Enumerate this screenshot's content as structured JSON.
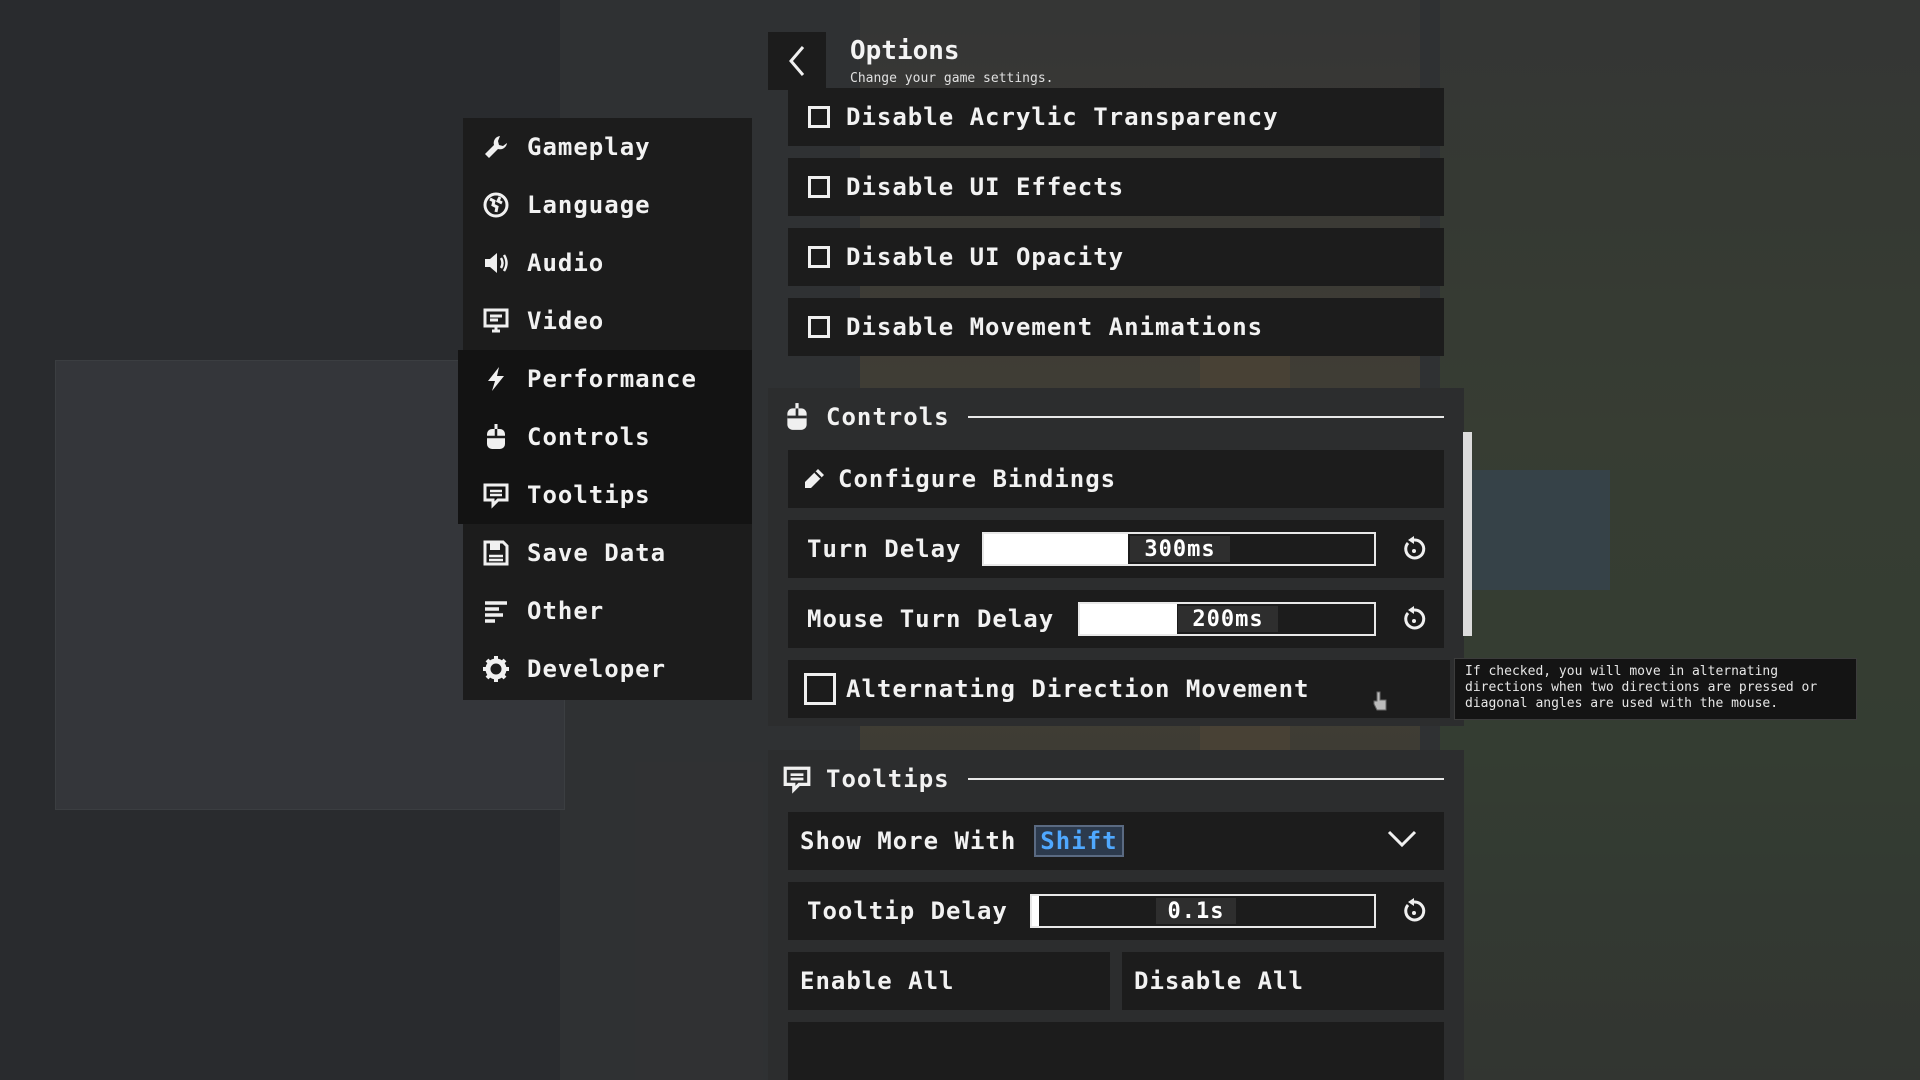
{
  "header": {
    "back_icon": "chevron-left-icon",
    "title": "Options",
    "subtitle": "Change your game settings."
  },
  "nav": {
    "items": [
      {
        "label": "Gameplay",
        "icon": "wrench-icon"
      },
      {
        "label": "Language",
        "icon": "globe-icon"
      },
      {
        "label": "Audio",
        "icon": "speaker-icon"
      },
      {
        "label": "Video",
        "icon": "monitor-icon"
      },
      {
        "label": "Performance",
        "icon": "lightning-icon",
        "active": true
      },
      {
        "label": "Controls",
        "icon": "mouse-icon",
        "active": true
      },
      {
        "label": "Tooltips",
        "icon": "speech-bubble-icon",
        "active": true
      },
      {
        "label": "Save Data",
        "icon": "save-icon"
      },
      {
        "label": "Other",
        "icon": "lines-icon"
      },
      {
        "label": "Developer",
        "icon": "gear-icon"
      }
    ]
  },
  "performance": {
    "options": [
      {
        "label": "Disable Acrylic Transparency",
        "checked": false
      },
      {
        "label": "Disable UI Effects",
        "checked": false
      },
      {
        "label": "Disable UI Opacity",
        "checked": false
      },
      {
        "label": "Disable Movement Animations",
        "checked": false
      }
    ]
  },
  "controls": {
    "title": "Controls",
    "configure_label": "Configure Bindings",
    "turn_delay": {
      "label": "Turn Delay",
      "value": "300ms",
      "fraction": 0.37
    },
    "mouse_turn_delay": {
      "label": "Mouse Turn Delay",
      "value": "200ms",
      "fraction": 0.33
    },
    "alternating": {
      "label": "Alternating Direction Movement",
      "checked": false
    }
  },
  "tooltip": {
    "text": "If checked, you will move in alternating directions when two directions are pressed or diagonal angles are used with the mouse."
  },
  "tooltips_section": {
    "title": "Tooltips",
    "show_more_label": "Show More With",
    "show_more_key": "Shift",
    "tooltip_delay": {
      "label": "Tooltip Delay",
      "value": "0.1s",
      "fraction": 0.02
    },
    "enable_all": "Enable All",
    "disable_all": "Disable All"
  },
  "colors": {
    "panel": "#1c1c1c",
    "section_bg": "#2c2d2e",
    "accent_key": "#4fa8ff"
  }
}
